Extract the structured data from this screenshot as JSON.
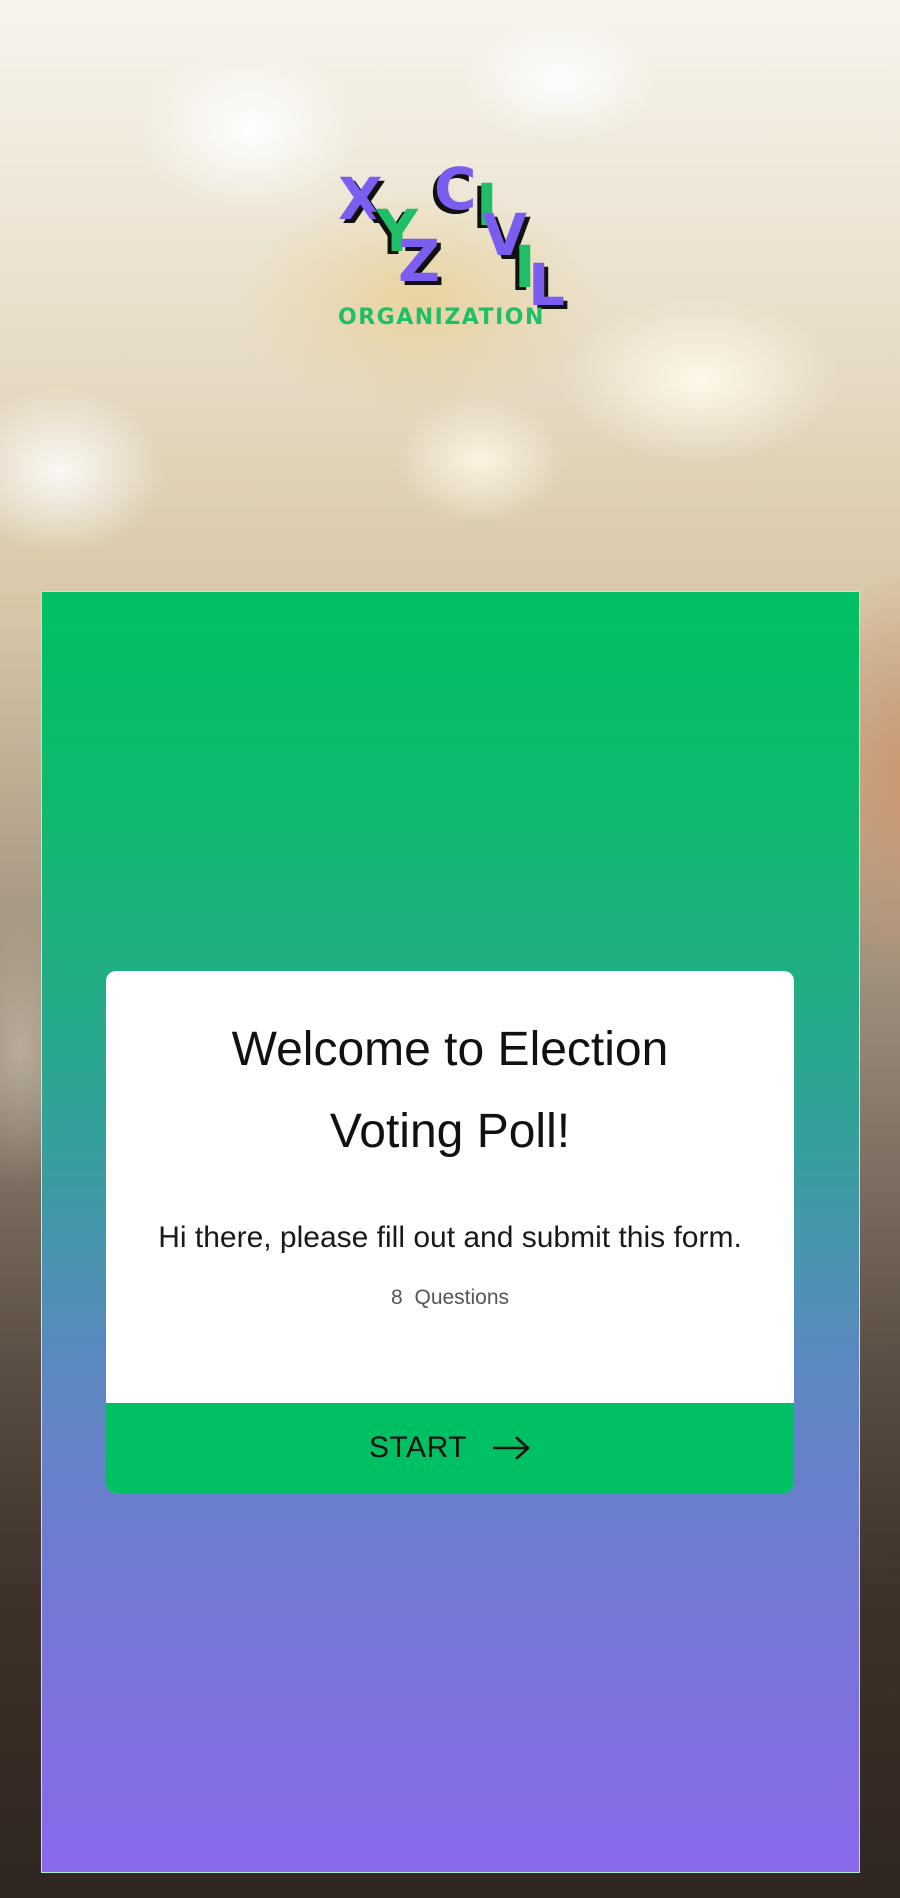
{
  "logo": {
    "letters": [
      "X",
      "Y",
      "Z",
      "C",
      "I",
      "V",
      "I",
      "L"
    ],
    "subtitle": "ORGANIZATION",
    "primary_color": "#7b5ef0",
    "accent_color": "#1fbe67"
  },
  "card": {
    "title_line1": "Welcome to Election",
    "title_line2": "Voting Poll!",
    "description": "Hi there, please fill out and submit this form.",
    "question_count": "8",
    "question_label": "Questions",
    "start_label": "START",
    "start_icon": "arrow-right-icon"
  },
  "colors": {
    "button": "#00c063",
    "gradient_top": "#00c063",
    "gradient_bottom": "#8a68ec"
  }
}
